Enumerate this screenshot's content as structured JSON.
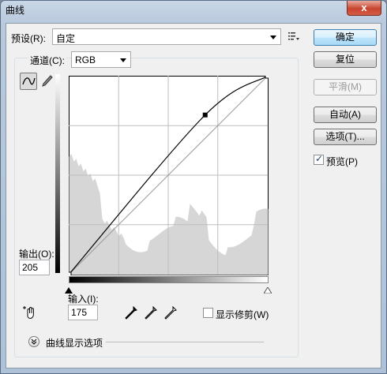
{
  "window": {
    "title": "曲线",
    "close_label": "x"
  },
  "preset": {
    "label": "预设(R):",
    "value": "自定"
  },
  "channel": {
    "label": "通道(C):",
    "value": "RGB"
  },
  "buttons": {
    "ok": "确定",
    "reset": "复位",
    "smooth": "平滑(M)",
    "auto": "自动(A)",
    "options": "选项(T)..."
  },
  "preview": {
    "label": "预览(P)",
    "checked": true
  },
  "output": {
    "label": "输出(O):",
    "value": "205"
  },
  "input": {
    "label": "输入(I):",
    "value": "175"
  },
  "show_clipping": {
    "label": "显示修剪(W)",
    "checked": false
  },
  "curve_display_options": {
    "label": "曲线显示选项"
  },
  "curve": {
    "control_points": [
      [
        0,
        0
      ],
      [
        175,
        205
      ],
      [
        255,
        255
      ]
    ]
  }
}
